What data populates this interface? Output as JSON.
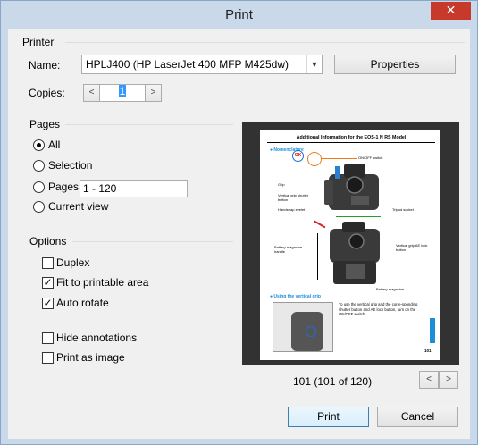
{
  "window": {
    "title": "Print",
    "close_glyph": "✕"
  },
  "printer": {
    "section_label": "Printer",
    "name_label": "Name:",
    "name_value": "HPLJ400 (HP LaserJet 400 MFP M425dw)",
    "properties_label": "Properties",
    "copies_label": "Copies:",
    "copies_value": "1"
  },
  "pages": {
    "section_label": "Pages",
    "options": [
      {
        "label": "All",
        "selected": true
      },
      {
        "label": "Selection",
        "selected": false
      },
      {
        "label": "Pages",
        "selected": false
      },
      {
        "label": "Current view",
        "selected": false
      }
    ],
    "range_value": "1 - 120"
  },
  "options": {
    "section_label": "Options",
    "items": [
      {
        "label": "Duplex",
        "checked": false
      },
      {
        "label": "Fit to printable area",
        "checked": true
      },
      {
        "label": "Auto rotate",
        "checked": true
      },
      {
        "label": "Hide annotations",
        "checked": false
      },
      {
        "label": "Print as image",
        "checked": false
      }
    ]
  },
  "preview": {
    "page_title": "Additional Information for the EOS-1 N RS Model",
    "heading_1": "Nomenclature",
    "heading_2": "Using the vertical grip",
    "badge": "OK",
    "labels": {
      "onoff": "ON/OFF switch",
      "grip": "Grip",
      "vgrip_shutter": "Vertical grip shutter button",
      "handstrap": "Handstrap eyelet",
      "tripod": "Tripod socket",
      "battery_handle": "Battery magazine handle",
      "vgrip_ae": "Vertical grip AE lock button",
      "battery_mag": "Battery magazine"
    },
    "body_text": "To use the vertical grip and the corre-sponding shutter button and AE lock button, turn on the ON/OFF switch.",
    "page_number": "101",
    "status": "101 (101 of 120)"
  },
  "buttons": {
    "print": "Print",
    "cancel": "Cancel",
    "prev": "<",
    "next": ">"
  },
  "colors": {
    "accent": "#3399ff",
    "title_bar": "#c9d9ea",
    "close": "#c7392b"
  }
}
